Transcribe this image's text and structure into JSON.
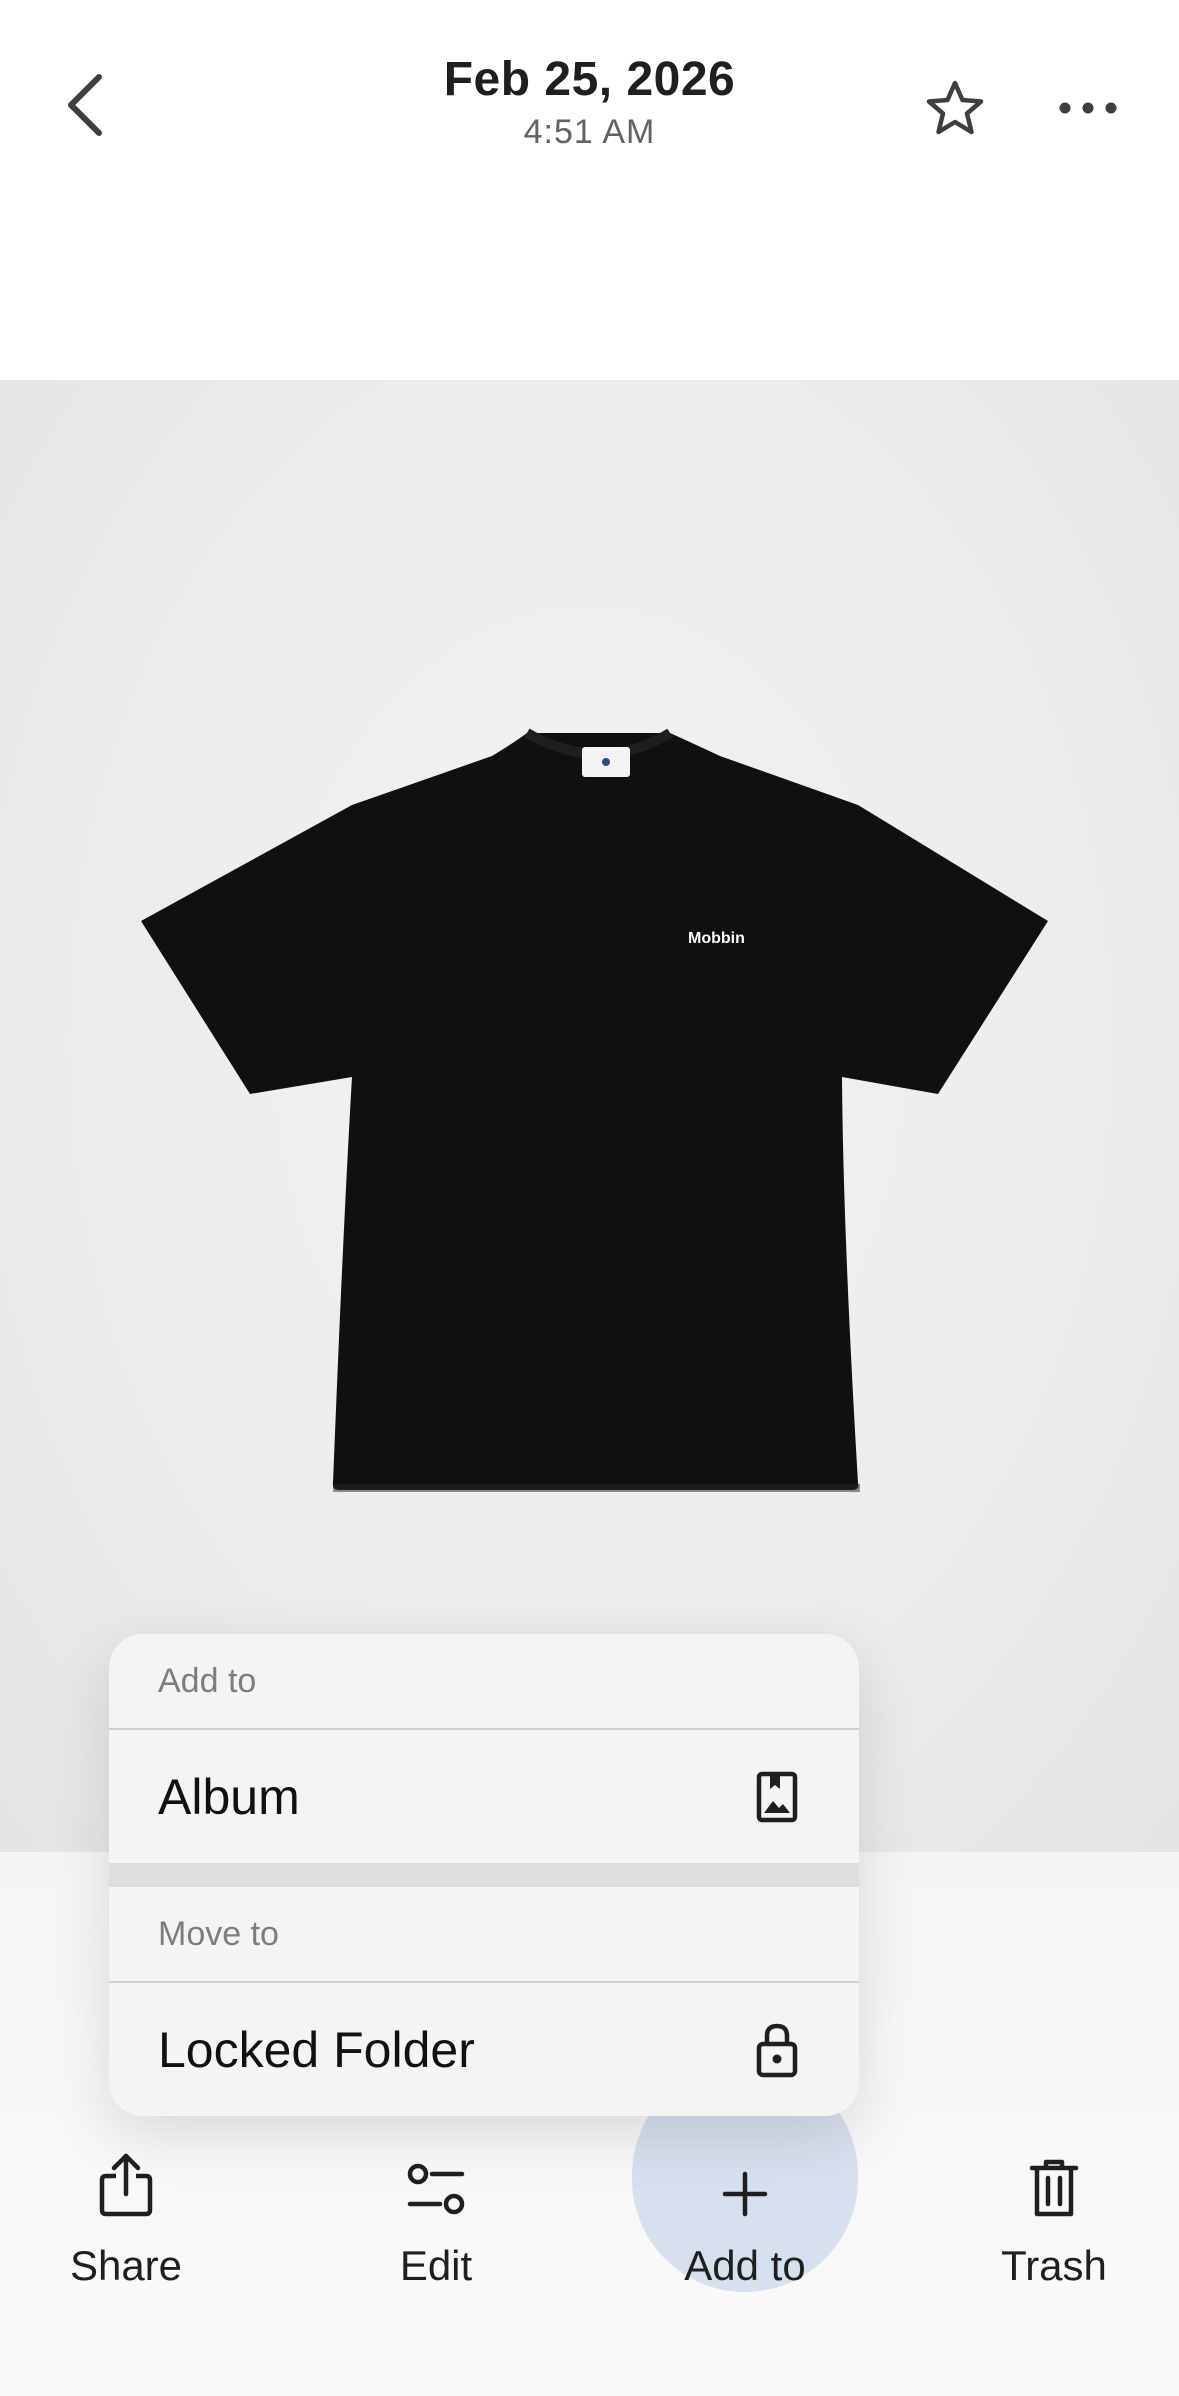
{
  "header": {
    "date": "Feb 25, 2026",
    "time": "4:51 AM",
    "icons": {
      "back": "chevron-left-icon",
      "favorite": "star-outline-icon",
      "more": "more-horizontal-icon"
    }
  },
  "photo": {
    "description_icon": "photo-tshirt",
    "chest_text": "Mobbin"
  },
  "menu": {
    "section1_header": "Add to",
    "album_label": "Album",
    "section2_header": "Move to",
    "locked_label": "Locked Folder",
    "icons": {
      "album": "album-icon",
      "locked": "lock-icon"
    }
  },
  "actions": {
    "share_label": "Share",
    "edit_label": "Edit",
    "add_label": "Add to",
    "trash_label": "Trash",
    "active": "Add to",
    "colors": {
      "active_bg": "#d7e0ee",
      "text": "#1f1f1f"
    }
  }
}
